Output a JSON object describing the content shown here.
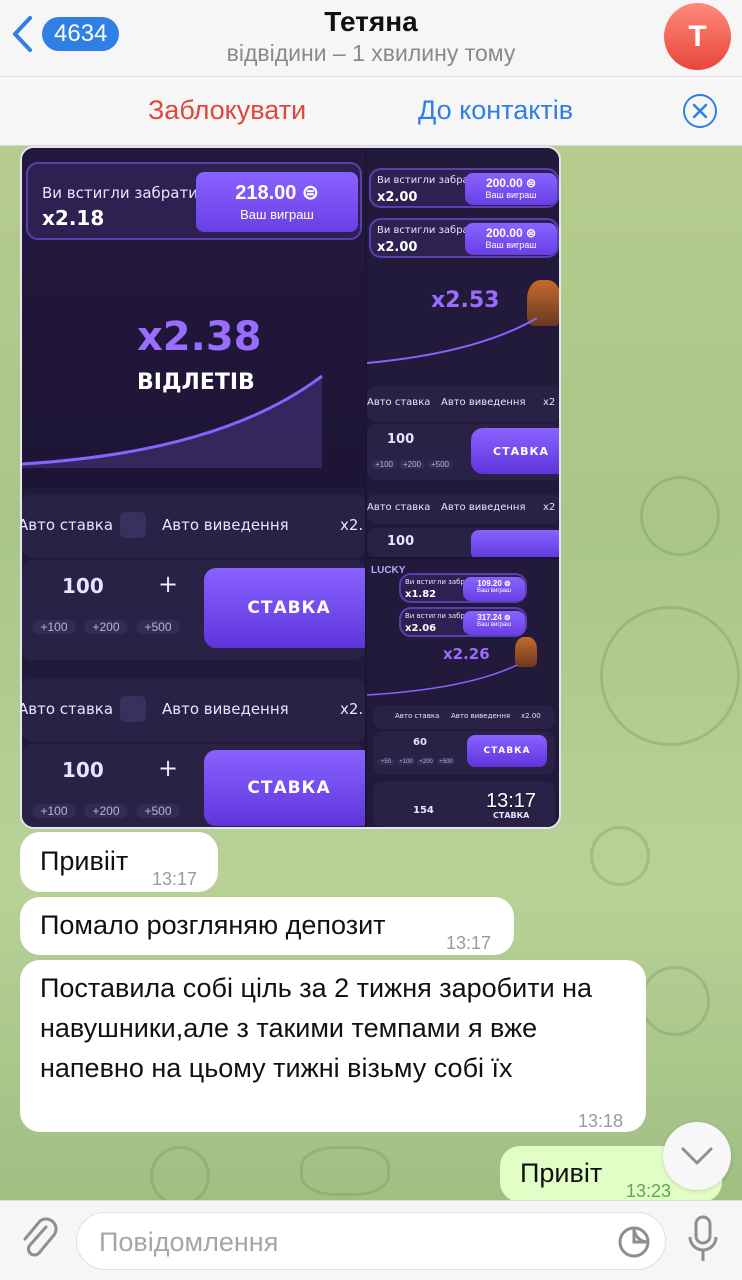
{
  "header": {
    "back_count": "4634",
    "contact_name": "Тетяна",
    "status": "відвідини – 1 хвилину тому",
    "avatar_letter": "Т"
  },
  "action_bar": {
    "block_label": "Заблокувати",
    "add_contact_label": "До контактів"
  },
  "album": {
    "time": "13:17",
    "shot_main": {
      "win_title": "Ви встигли забрати!",
      "win_mult": "x2.18",
      "win_amount": "218.00 ⊜",
      "win_caption": "Ваш виграш",
      "flight_mult": "x2.38",
      "flight_caption": "ВІДЛЕТІВ",
      "auto_bet": "Авто ставка",
      "auto_cashout": "Авто виведення",
      "cashout_value": "x2.",
      "bet_amount": "100",
      "plus": "+",
      "chips": [
        "+100",
        "+200",
        "+500"
      ],
      "bet_button": "СТАВКА"
    },
    "shot_top_right": {
      "wins": [
        {
          "title": "Ви встигли забрати!",
          "mult": "x2.00",
          "amount": "200.00 ⊜",
          "caption": "Ваш виграш"
        },
        {
          "title": "Ви встигли забрати!",
          "mult": "x2.00",
          "amount": "200.00 ⊜",
          "caption": "Ваш виграш"
        }
      ],
      "flight_mult": "x2.53",
      "auto_bet": "Авто ставка",
      "auto_cashout": "Авто виведення",
      "cashout_value": "x2",
      "bet_amount": "100",
      "chips": [
        "+100",
        "+200",
        "+500"
      ],
      "bet_button": "СТАВКА"
    },
    "shot_bottom_right": {
      "logo": "LUCKY",
      "wins": [
        {
          "title": "Ви встигли забрати!",
          "mult": "x1.82",
          "amount": "109.20 ⊜",
          "caption": "Ваш виграш"
        },
        {
          "title": "Ви встигли забрати!",
          "mult": "x2.06",
          "amount": "317.24 ⊜",
          "caption": "Ваш виграш"
        }
      ],
      "flight_mult": "x2.26",
      "auto_bet": "Авто ставка",
      "auto_cashout": "Авто виведення",
      "cashout_value": "x2.00",
      "bet_amount_1": "60",
      "bet_amount_2": "154",
      "chips": [
        "+50",
        "+100",
        "+200",
        "+500"
      ],
      "bet_button": "СТАВКА"
    }
  },
  "messages": [
    {
      "text": "Привіiт",
      "time": "13:17",
      "direction": "in"
    },
    {
      "text": "Помало розгляняю депозит",
      "time": "13:17",
      "direction": "in"
    },
    {
      "text": "Поставила собі ціль за 2 тижня заробити на навушники,але з такими темпами я вже напевно на цьому тижні візьму собі їх",
      "time": "13:18",
      "direction": "in"
    },
    {
      "text": "Привіт",
      "time": "13:23",
      "direction": "out",
      "status": "read"
    }
  ],
  "composer": {
    "placeholder": "Повідомлення"
  },
  "colors": {
    "accent": "#2f7fe4",
    "danger": "#e0463a",
    "outgoing_bubble": "#e1fec6",
    "game_purple": "#8a62ff"
  }
}
